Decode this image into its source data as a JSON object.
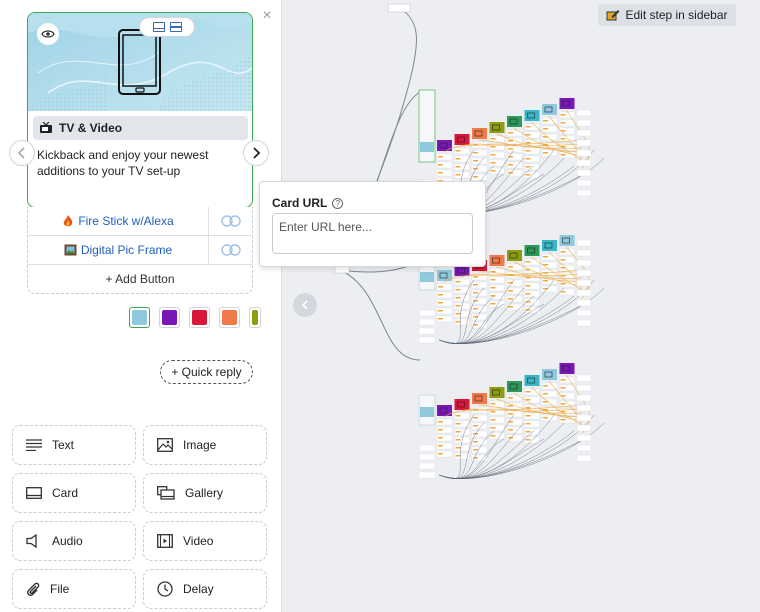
{
  "card": {
    "title": "TV & Video",
    "description": "Kickback and enjoy your newest additions to your TV set-up",
    "buttons": [
      {
        "label": "Fire Stick w/Alexa"
      },
      {
        "label": "Digital Pic Frame"
      }
    ],
    "add_button": "+ Add Button"
  },
  "thumbnails": [
    {
      "color": "#8ec9de"
    },
    {
      "color": "#7a17b8"
    },
    {
      "color": "#d8173a"
    },
    {
      "color": "#f07a4a"
    },
    {
      "color": "#8e9c12"
    }
  ],
  "quick_reply": "+ Quick reply",
  "tools": [
    {
      "label": "Text",
      "icon": "text-lines-icon"
    },
    {
      "label": "Image",
      "icon": "image-icon"
    },
    {
      "label": "Card",
      "icon": "card-icon"
    },
    {
      "label": "Gallery",
      "icon": "gallery-icon"
    },
    {
      "label": "Audio",
      "icon": "speaker-icon"
    },
    {
      "label": "Video",
      "icon": "video-icon"
    },
    {
      "label": "File",
      "icon": "paperclip-icon"
    },
    {
      "label": "Delay",
      "icon": "clock-icon"
    }
  ],
  "popover": {
    "label": "Card URL",
    "placeholder": "Enter URL here..."
  },
  "edit_step": "Edit step in sidebar",
  "colors": {
    "accent_green": "#3aa853",
    "link_blue": "#1f5fbf"
  }
}
